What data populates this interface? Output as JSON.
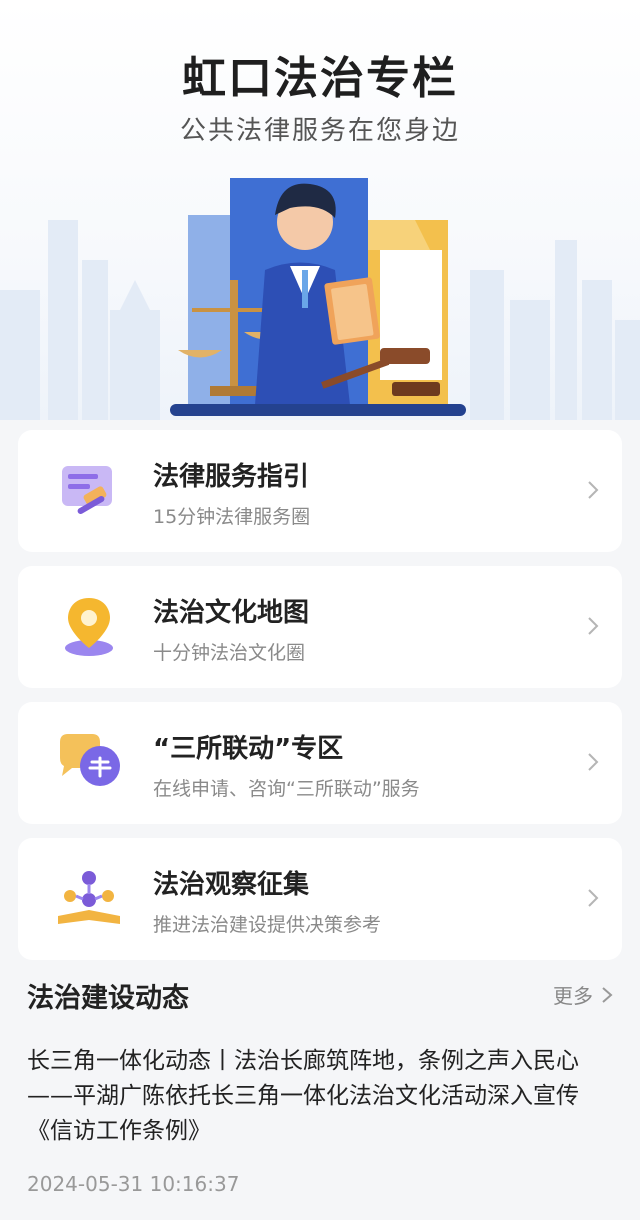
{
  "hero": {
    "title": "虹口法治专栏",
    "subtitle": "公共法律服务在您身边"
  },
  "cards": [
    {
      "title": "法律服务指引",
      "desc": "15分钟法律服务圈",
      "icon": "legal-guide-icon"
    },
    {
      "title": "法治文化地图",
      "desc": "十分钟法治文化圈",
      "icon": "map-pin-icon"
    },
    {
      "title": "“三所联动”专区",
      "desc": "在线申请、咨询“三所联动”服务",
      "icon": "chat-bubbles-icon"
    },
    {
      "title": "法治观察征集",
      "desc": "推进法治建设提供决策参考",
      "icon": "network-book-icon"
    }
  ],
  "news_section": {
    "title": "法治建设动态",
    "more_label": "更多"
  },
  "news": [
    {
      "title": "长三角一体化动态丨法治长廊筑阵地，条例之声入民心——平湖广陈依托长三角一体化法治文化活动深入宣传《信访工作条例》",
      "time": "2024-05-31 10:16:37"
    }
  ],
  "colors": {
    "page_bg": "#f5f6f8",
    "card_bg": "#ffffff",
    "accent_blue": "#3b62c9",
    "gold": "#f2b441"
  }
}
